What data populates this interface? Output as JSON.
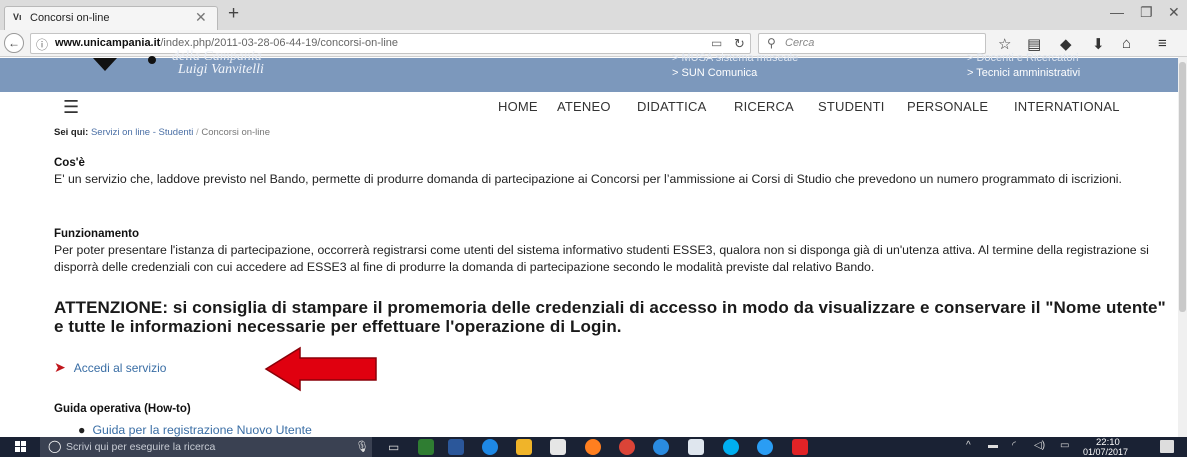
{
  "browser": {
    "tab_favicon": "Vı",
    "tab_title": "Concorsi on-line",
    "tab_close": "✕",
    "new_tab": "+",
    "minimize": "—",
    "restore": "❐",
    "close": "✕",
    "back": "←",
    "url_domain": "www.unicampania.it",
    "url_path": "/index.php/2011-03-28-06-44-19/concorsi-on-line",
    "search_placeholder": "Cerca"
  },
  "site_header": {
    "logo_line1": "Luigi Vanvitelli",
    "logo_cut_text": "della Campania",
    "links_mid": [
      "> MUSA sistema museale",
      "> SUN Comunica"
    ],
    "links_right": [
      "> Docenti e Ricercatori",
      "> Tecnici amministrativi"
    ]
  },
  "menu": {
    "items": [
      "HOME",
      "ATENEO",
      "DIDATTICA",
      "RICERCA",
      "STUDENTI",
      "PERSONALE",
      "INTERNATIONAL"
    ]
  },
  "breadcrumb": {
    "prefix": "Sei qui:",
    "link": "Servizi on line - Studenti",
    "separator": "/",
    "current": "Concorsi on-line"
  },
  "sections": {
    "cose_title": "Cos'è",
    "cose_text": "E' un servizio che, laddove previsto nel Bando, permette di produrre domanda di partecipazione ai Concorsi per l’ammissione ai Corsi di Studio che prevedono un numero programmato di iscrizioni.",
    "funz_title": "Funzionamento",
    "funz_text": "Per poter presentare l'istanza di partecipazione, occorrerà registrarsi come utenti del sistema informativo studenti ESSE3, qualora non si disponga già di un'utenza attiva. Al termine della registrazione si disporrà delle credenziali con cui accedere ad ESSE3 al fine di produrre la domanda di partecipazione secondo le modalità previste dal relativo Bando.",
    "attention": "ATTENZIONE: si consiglia di stampare il promemoria delle credenziali di accesso in modo da visualizzare e conservare il \"Nome utente\" e tutte le informazioni necessarie per effettuare l'operazione di Login.",
    "access_chevron": "➤",
    "access_link": "Accedi al servizio",
    "howto_title": "Guida operativa (How-to)",
    "howto_items": [
      "Guida per la registrazione Nuovo Utente"
    ]
  },
  "taskbar": {
    "search_placeholder": "Scrivi qui per eseguire la ricerca",
    "time": "22:10",
    "date": "01/07/2017"
  },
  "colors": {
    "header_blue": "#7c98bc",
    "link_blue": "#3a6ea5",
    "arrow_red": "#e0000f",
    "taskbar": "#1a2234"
  }
}
